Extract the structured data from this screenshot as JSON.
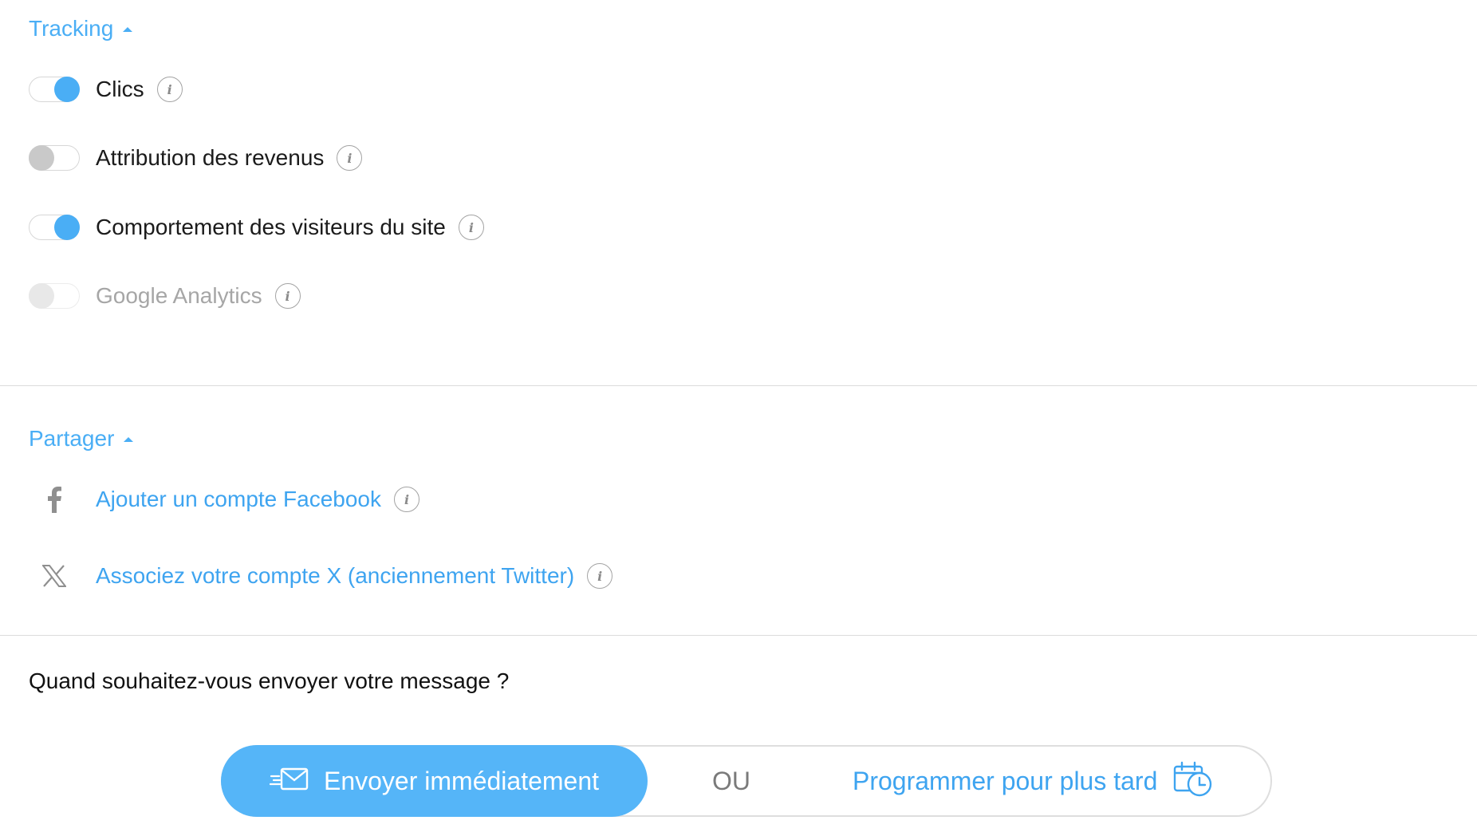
{
  "tracking": {
    "title": "Tracking",
    "items": [
      {
        "label": "Clics",
        "state": "on"
      },
      {
        "label": "Attribution des revenus",
        "state": "off"
      },
      {
        "label": "Comportement des visiteurs du site",
        "state": "on"
      },
      {
        "label": "Google Analytics",
        "state": "disabled"
      }
    ]
  },
  "share": {
    "title": "Partager",
    "facebook_label": "Ajouter un compte Facebook",
    "x_label": "Associez votre compte X (anciennement Twitter)"
  },
  "send": {
    "question": "Quand souhaitez-vous envoyer votre message ?",
    "now_label": "Envoyer immédiatement",
    "or_label": "OU",
    "later_label": "Programmer pour plus tard"
  },
  "icons": {
    "info": "info-icon",
    "facebook": "facebook-icon",
    "x": "x-logo-icon",
    "send": "envelope-send-icon",
    "schedule": "calendar-clock-icon"
  },
  "colors": {
    "accent": "#4aaef5",
    "primary_button": "#55b5f8",
    "link": "#3ea4f0",
    "toggle_off": "#c9c9c9",
    "muted_text": "#a6a6a6"
  }
}
